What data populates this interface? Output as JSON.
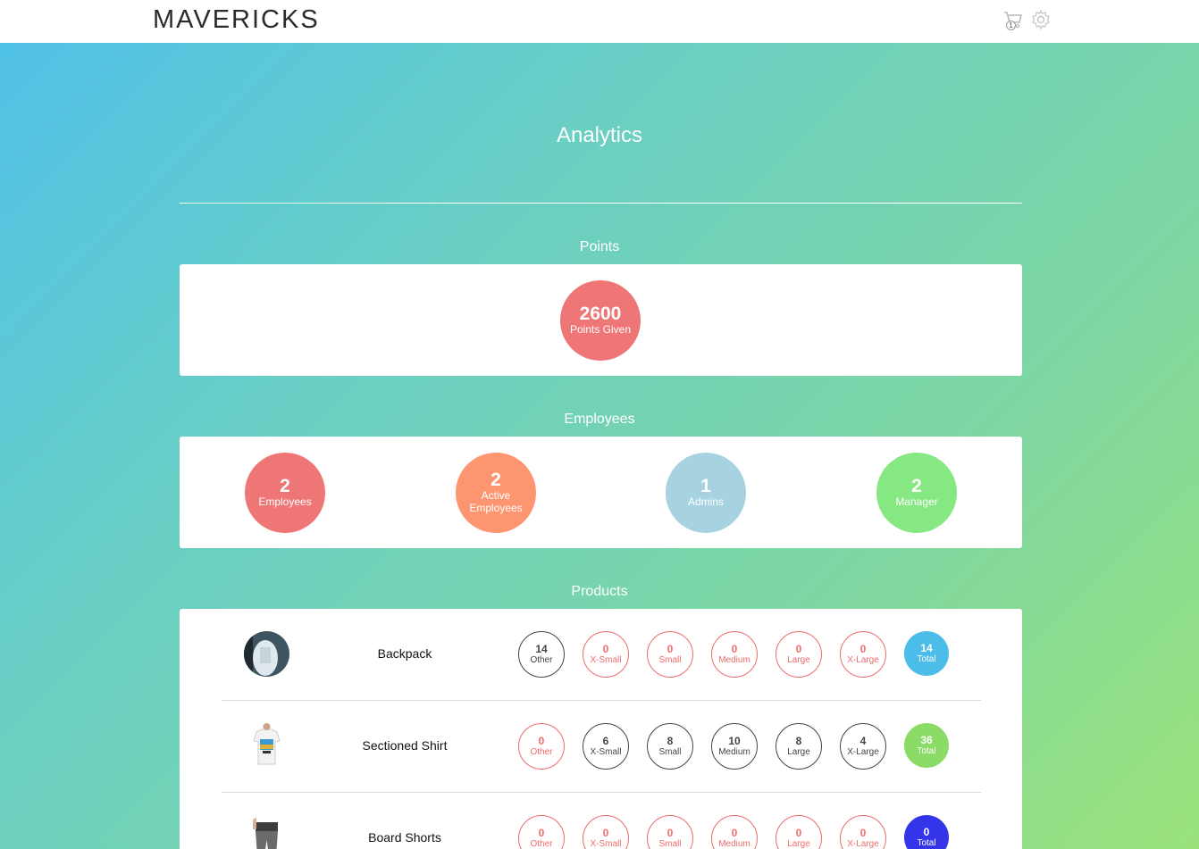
{
  "header": {
    "logo": "MAVERICKS",
    "cart_count": "1",
    "cart_icon": "cart-icon",
    "settings_icon": "gear-icon"
  },
  "page": {
    "title": "Analytics"
  },
  "points": {
    "title": "Points",
    "stats": [
      {
        "value": "2600",
        "label": "Points Given",
        "color": "#ef7676"
      }
    ]
  },
  "employees": {
    "title": "Employees",
    "stats": [
      {
        "value": "2",
        "label": "Employees",
        "color": "#ef7676"
      },
      {
        "value": "2",
        "label": "Active Employees",
        "color": "#fd9670"
      },
      {
        "value": "1",
        "label": "Admins",
        "color": "#a7d3e0"
      },
      {
        "value": "2",
        "label": "Manager",
        "color": "#85e882"
      }
    ]
  },
  "products": {
    "title": "Products",
    "items": [
      {
        "name": "Backpack",
        "sizes": [
          {
            "count": "14",
            "label": "Other"
          },
          {
            "count": "0",
            "label": "X-Small"
          },
          {
            "count": "0",
            "label": "Small"
          },
          {
            "count": "0",
            "label": "Medium"
          },
          {
            "count": "0",
            "label": "Large"
          },
          {
            "count": "0",
            "label": "X-Large"
          }
        ],
        "total": {
          "count": "14",
          "label": "Total",
          "color": "#4cbde9"
        }
      },
      {
        "name": "Sectioned Shirt",
        "sizes": [
          {
            "count": "0",
            "label": "Other"
          },
          {
            "count": "6",
            "label": "X-Small"
          },
          {
            "count": "8",
            "label": "Small"
          },
          {
            "count": "10",
            "label": "Medium"
          },
          {
            "count": "8",
            "label": "Large"
          },
          {
            "count": "4",
            "label": "X-Large"
          }
        ],
        "total": {
          "count": "36",
          "label": "Total",
          "color": "#8bdc67"
        }
      },
      {
        "name": "Board Shorts",
        "sizes": [
          {
            "count": "0",
            "label": "Other"
          },
          {
            "count": "0",
            "label": "X-Small"
          },
          {
            "count": "0",
            "label": "Small"
          },
          {
            "count": "0",
            "label": "Medium"
          },
          {
            "count": "0",
            "label": "Large"
          },
          {
            "count": "0",
            "label": "X-Large"
          }
        ],
        "total": {
          "count": "0",
          "label": "Total",
          "color": "#3434e8"
        }
      }
    ]
  }
}
